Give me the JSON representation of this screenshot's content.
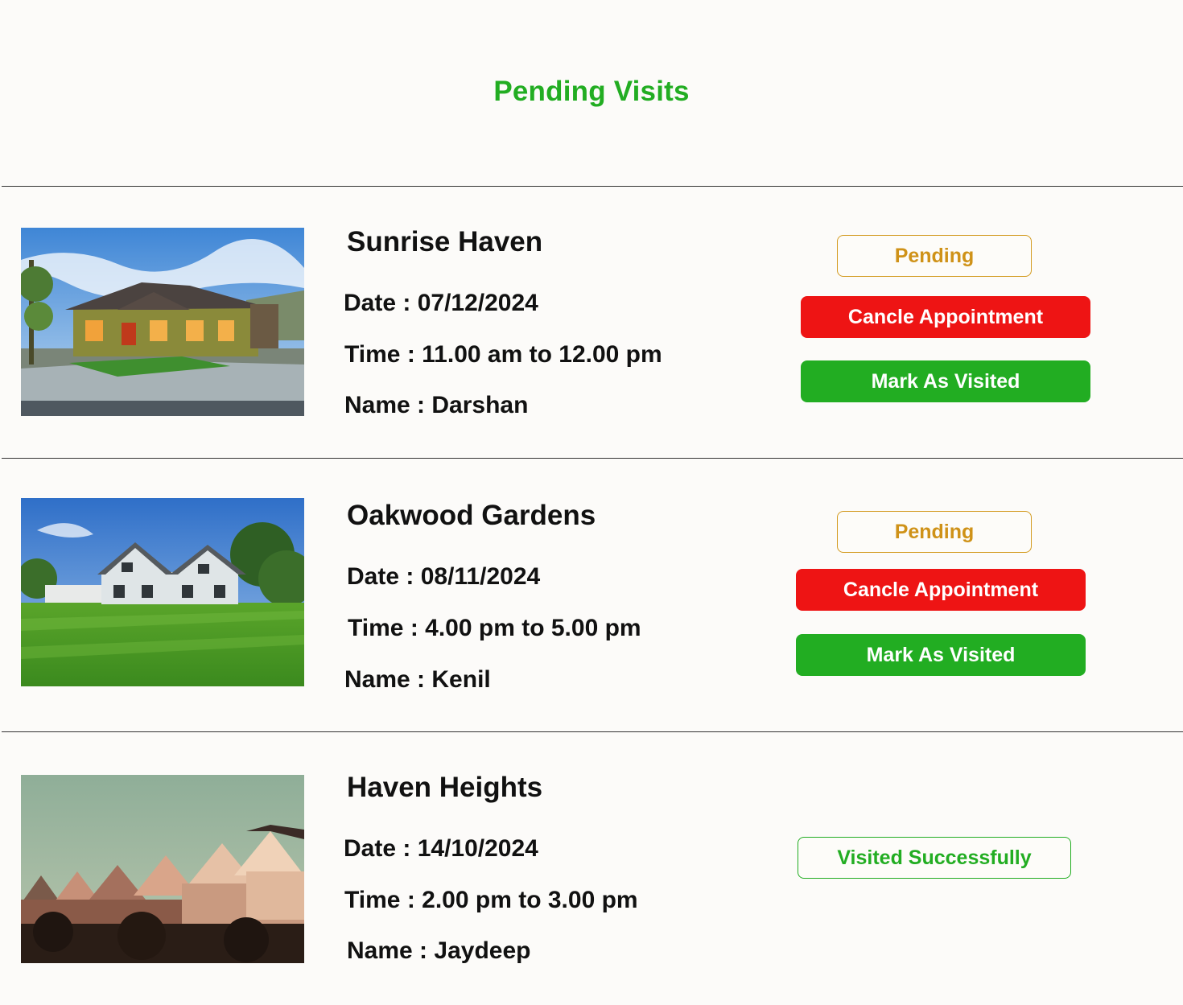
{
  "page": {
    "title": "Pending Visits"
  },
  "labels": {
    "date": "Date :",
    "time": "Time :",
    "name": "Name :",
    "pending": "Pending",
    "cancel": "Cancle Appointment",
    "mark_visited": "Mark As Visited",
    "visited_success": "Visited Successfully"
  },
  "visits": [
    {
      "property": "Sunrise Haven",
      "date": "07/12/2024",
      "time": "11.00 am to 12.00 pm",
      "name": "Darshan",
      "status": "Pending"
    },
    {
      "property": "Oakwood Gardens",
      "date": "08/11/2024",
      "time": "4.00 pm to 5.00 pm",
      "name": "Kenil",
      "status": "Pending"
    },
    {
      "property": "Haven Heights",
      "date": "14/10/2024",
      "time": "2.00 pm to 3.00 pm",
      "name": "Jaydeep",
      "status": "Visited Successfully"
    }
  ],
  "colors": {
    "accent_green": "#22ad22",
    "cancel_red": "#ee1414",
    "pending_amber": "#cf9218",
    "background": "#fcfbf9"
  }
}
